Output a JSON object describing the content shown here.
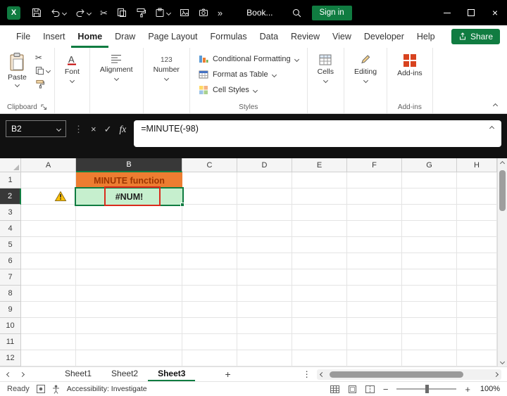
{
  "colors": {
    "accent_green": "#107C41",
    "title_bar_bg": "#000000",
    "b1_bg": "#ED7D31",
    "b1_text": "#9C3400",
    "b2_bg": "#C6EFCE",
    "b2_text": "#1F1F1F",
    "annotation_red": "#D92B1C",
    "selection_green": "#107C41",
    "warning_yellow": "#FFC107"
  },
  "titlebar": {
    "title": "Book...",
    "signin_label": "Sign in",
    "icons": [
      "excel-logo",
      "save",
      "undo",
      "redo",
      "cut",
      "copy",
      "format-painter",
      "paste",
      "picture",
      "camera",
      "more-commands",
      "search",
      "minimize",
      "maximize",
      "close"
    ]
  },
  "menubar": {
    "tabs": [
      "File",
      "Insert",
      "Home",
      "Draw",
      "Page Layout",
      "Formulas",
      "Data",
      "Review",
      "View",
      "Developer",
      "Help"
    ],
    "active_tab": "Home",
    "share_label": "Share"
  },
  "ribbon": {
    "paste_label": "Paste",
    "clipboard_group_label": "Clipboard",
    "font_label": "Font",
    "alignment_label": "Alignment",
    "number_label": "Number",
    "styles_items": [
      "Conditional Formatting",
      "Format as Table",
      "Cell Styles"
    ],
    "styles_group_label": "Styles",
    "cells_label": "Cells",
    "editing_label": "Editing",
    "addins_label": "Add-ins",
    "addins_group_label": "Add-ins"
  },
  "formula_bar": {
    "name_box_value": "B2",
    "fx_label": "fx",
    "formula": "=MINUTE(-98)"
  },
  "grid": {
    "columns": [
      "A",
      "B",
      "C",
      "D",
      "E",
      "F",
      "G",
      "H"
    ],
    "rows": [
      1,
      2,
      3,
      4,
      5,
      6,
      7,
      8,
      9,
      10,
      11,
      12
    ],
    "selected_column": "B",
    "selected_row": 2,
    "cells": {
      "B1": {
        "text": "MINUTE function"
      },
      "B2": {
        "text": "#NUM!"
      }
    }
  },
  "sheetbar": {
    "tabs": [
      "Sheet1",
      "Sheet2",
      "Sheet3"
    ],
    "active_tab": "Sheet3",
    "add_sheet_label": "+"
  },
  "statusbar": {
    "ready_label": "Ready",
    "accessibility_label": "Accessibility: Investigate",
    "zoom_value": "100%"
  }
}
